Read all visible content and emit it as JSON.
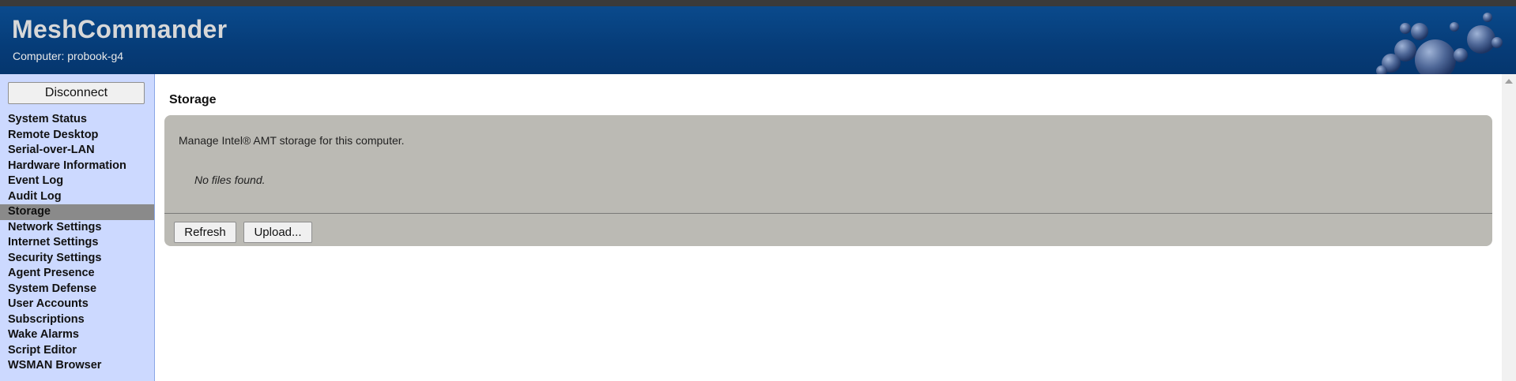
{
  "header": {
    "app_title": "MeshCommander",
    "computer_line": "Computer: probook-g4"
  },
  "sidebar": {
    "disconnect_label": "Disconnect",
    "items": [
      {
        "label": "System Status"
      },
      {
        "label": "Remote Desktop"
      },
      {
        "label": "Serial-over-LAN"
      },
      {
        "label": "Hardware Information"
      },
      {
        "label": "Event Log"
      },
      {
        "label": "Audit Log"
      },
      {
        "label": "Storage",
        "active": true
      },
      {
        "label": "Network Settings"
      },
      {
        "label": "Internet Settings"
      },
      {
        "label": "Security Settings"
      },
      {
        "label": "Agent Presence"
      },
      {
        "label": "System Defense"
      },
      {
        "label": "User Accounts"
      },
      {
        "label": "Subscriptions"
      },
      {
        "label": "Wake Alarms"
      },
      {
        "label": "Script Editor"
      },
      {
        "label": "WSMAN Browser"
      }
    ]
  },
  "main": {
    "page_title": "Storage",
    "description": "Manage Intel® AMT storage for this computer.",
    "empty_message": "No files found.",
    "refresh_label": "Refresh",
    "upload_label": "Upload..."
  },
  "colors": {
    "header_bg": "#063c78",
    "sidebar_bg": "#ccd9ff",
    "active_item_bg": "#8a8a8a",
    "panel_bg": "#bbbab4"
  },
  "icons": [
    "bubbles-logo-icon",
    "scroll-up-icon"
  ]
}
